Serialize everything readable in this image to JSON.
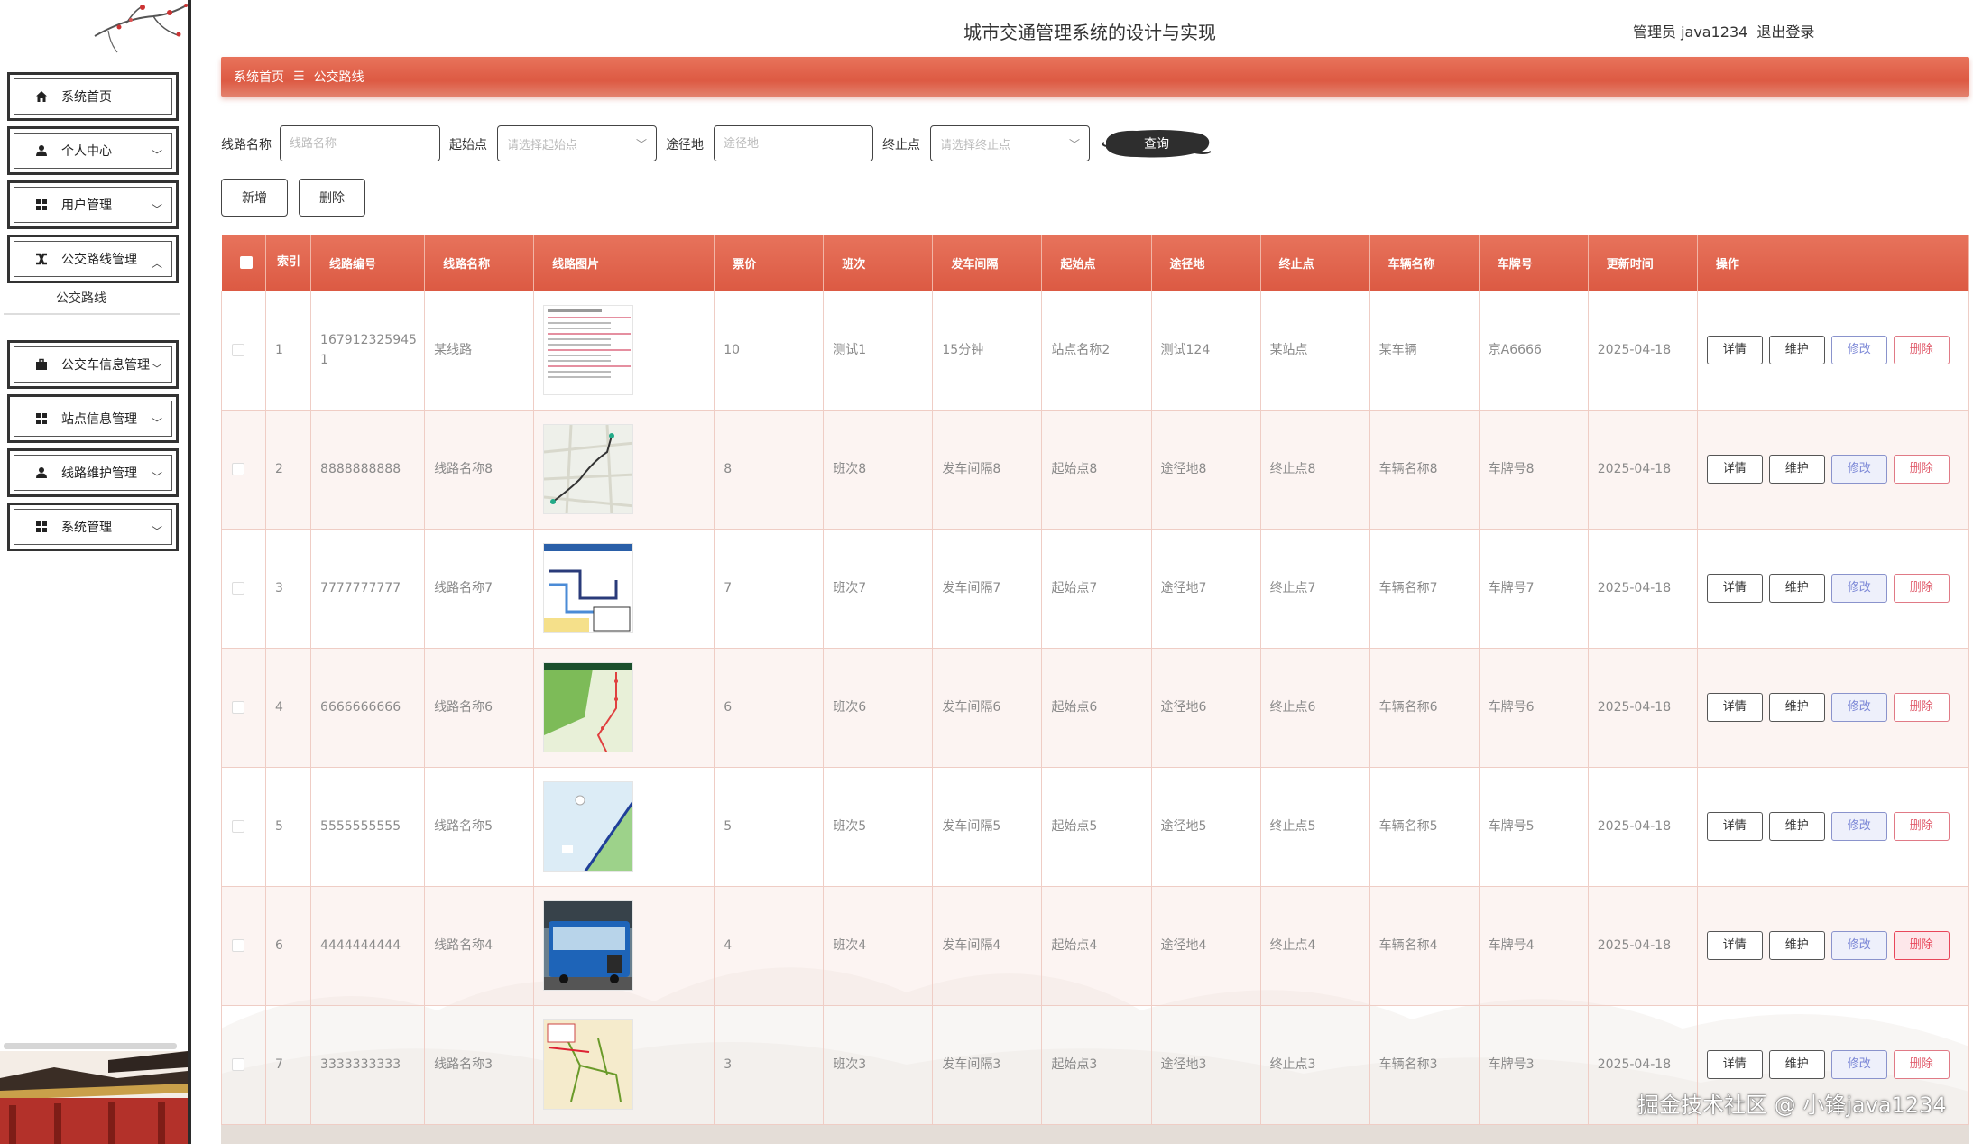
{
  "header": {
    "title": "城市交通管理系统的设计与实现",
    "user": "管理员 java1234",
    "logout": "退出登录"
  },
  "sidebar": {
    "items": [
      {
        "label": "系统首页",
        "icon": "home-icon",
        "has_chevron": false,
        "expanded": false
      },
      {
        "label": "个人中心",
        "icon": "user-icon",
        "has_chevron": true,
        "expanded": false
      },
      {
        "label": "用户管理",
        "icon": "grid-icon",
        "has_chevron": true,
        "expanded": false
      },
      {
        "label": "公交路线管理",
        "icon": "route-icon",
        "has_chevron": true,
        "expanded": true
      },
      {
        "label": "公交车信息管理",
        "icon": "briefcase-icon",
        "has_chevron": true,
        "expanded": false
      },
      {
        "label": "站点信息管理",
        "icon": "grid-icon",
        "has_chevron": true,
        "expanded": false
      },
      {
        "label": "线路维护管理",
        "icon": "user-icon",
        "has_chevron": true,
        "expanded": false
      },
      {
        "label": "系统管理",
        "icon": "grid-icon",
        "has_chevron": true,
        "expanded": false
      }
    ],
    "submenu": "公交路线"
  },
  "breadcrumb": {
    "home": "系统首页",
    "separator": "☰",
    "current": "公交路线"
  },
  "search": {
    "route_name_label": "线路名称",
    "route_name_placeholder": "线路名称",
    "start_label": "起始点",
    "start_placeholder": "请选择起始点",
    "via_label": "途径地",
    "via_placeholder": "途径地",
    "end_label": "终止点",
    "end_placeholder": "请选择终止点",
    "search_button": "查询"
  },
  "actions": {
    "add": "新增",
    "delete": "删除"
  },
  "table": {
    "columns": [
      "索引",
      "线路编号",
      "线路名称",
      "线路图片",
      "票价",
      "班次",
      "发车间隔",
      "起始点",
      "途径地",
      "终止点",
      "车辆名称",
      "车牌号",
      "更新时间",
      "操作"
    ],
    "op_labels": {
      "detail": "详情",
      "maintain": "维护",
      "edit": "修改",
      "delete": "删除"
    },
    "rows": [
      {
        "index": "1",
        "code": "1679123259451",
        "name": "某线路",
        "image": "timetable",
        "price": "10",
        "shift": "测试1",
        "interval": "15分钟",
        "start": "站点名称2",
        "via": "测试124",
        "end": "某站点",
        "vehicle": "某车辆",
        "plate": "京A6666",
        "updated": "2025-04-18"
      },
      {
        "index": "2",
        "code": "8888888888",
        "name": "线路名称8",
        "image": "city-map",
        "price": "8",
        "shift": "班次8",
        "interval": "发车间隔8",
        "start": "起始点8",
        "via": "途径地8",
        "end": "终止点8",
        "vehicle": "车辆名称8",
        "plate": "车牌号8",
        "updated": "2025-04-18"
      },
      {
        "index": "3",
        "code": "7777777777",
        "name": "线路名称7",
        "image": "route-diagram",
        "price": "7",
        "shift": "班次7",
        "interval": "发车间隔7",
        "start": "起始点7",
        "via": "途径地7",
        "end": "终止点7",
        "vehicle": "车辆名称7",
        "plate": "车牌号7",
        "updated": "2025-04-18"
      },
      {
        "index": "4",
        "code": "6666666666",
        "name": "线路名称6",
        "image": "green-map",
        "price": "6",
        "shift": "班次6",
        "interval": "发车间隔6",
        "start": "起始点6",
        "via": "途径地6",
        "end": "终止点6",
        "vehicle": "车辆名称6",
        "plate": "车牌号6",
        "updated": "2025-04-18"
      },
      {
        "index": "5",
        "code": "5555555555",
        "name": "线路名称5",
        "image": "coast-map",
        "price": "5",
        "shift": "班次5",
        "interval": "发车间隔5",
        "start": "起始点5",
        "via": "途径地5",
        "end": "终止点5",
        "vehicle": "车辆名称5",
        "plate": "车牌号5",
        "updated": "2025-04-18"
      },
      {
        "index": "6",
        "code": "4444444444",
        "name": "线路名称4",
        "image": "bus-photo",
        "price": "4",
        "shift": "班次4",
        "interval": "发车间隔4",
        "start": "起始点4",
        "via": "途径地4",
        "end": "终止点4",
        "vehicle": "车辆名称4",
        "plate": "车牌号4",
        "updated": "2025-04-18"
      },
      {
        "index": "7",
        "code": "3333333333",
        "name": "线路名称3",
        "image": "yellow-map",
        "price": "3",
        "shift": "班次3",
        "interval": "发车间隔3",
        "start": "起始点3",
        "via": "途径地3",
        "end": "终止点3",
        "vehicle": "车辆名称3",
        "plate": "车牌号3",
        "updated": "2025-04-18"
      }
    ]
  },
  "watermark": "掘金技术社区 @ 小锋java1234",
  "colors": {
    "accent": "#dd5a43",
    "edit": "#7a86d6",
    "delete": "#e05a6a"
  }
}
